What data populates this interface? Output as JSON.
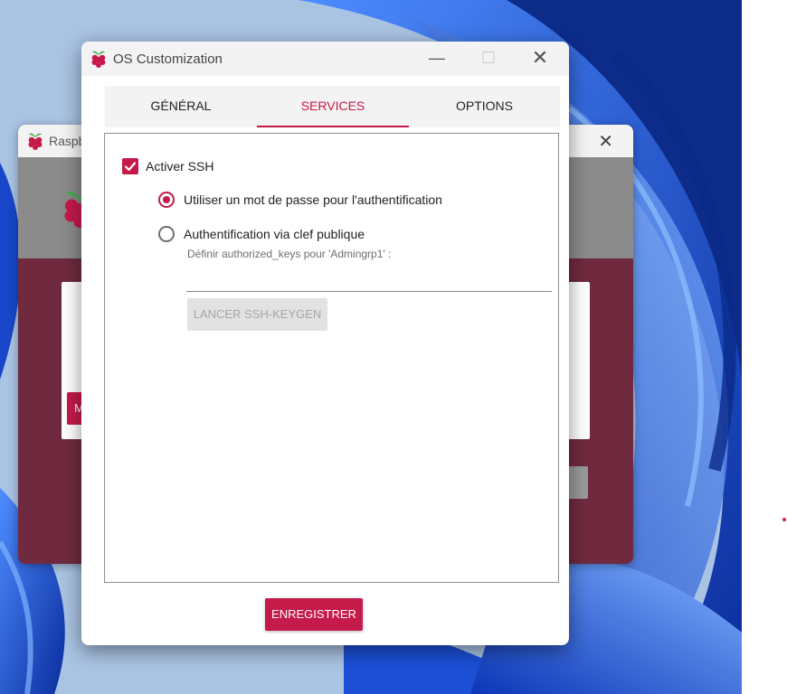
{
  "desktop": {
    "colors": {
      "sky": "#a9c3e3",
      "bloom_dark": "#0a2d9e",
      "bloom_mid": "#1a5de8",
      "bloom_light": "#4d8cff"
    }
  },
  "background_window": {
    "title": "Raspb",
    "icon": "raspberry-icon",
    "close_icon": "close-icon",
    "button_label": "M",
    "colors": {
      "body": "#6f2a3f",
      "header": "#8b8b8b"
    }
  },
  "dialog": {
    "title": "OS Customization",
    "icon": "raspberry-icon",
    "window_controls": {
      "minimize": "—",
      "maximize": "☐",
      "close": "✕"
    },
    "tabs": [
      {
        "label": "GÉNÉRAL",
        "active": false
      },
      {
        "label": "SERVICES",
        "active": true
      },
      {
        "label": "OPTIONS",
        "active": false
      }
    ],
    "services": {
      "ssh_checkbox_label": "Activer SSH",
      "ssh_enabled": true,
      "radio_password_label": "Utiliser un mot de passe pour l'authentification",
      "radio_password_selected": true,
      "radio_pubkey_label": "Authentification via clef publique",
      "radio_pubkey_selected": false,
      "authorized_keys_hint": "Définir authorized_keys pour 'Admingrp1' :",
      "authorized_keys_value": "",
      "keygen_button": "LANCER SSH-KEYGEN"
    },
    "save_button": "ENREGISTRER",
    "colors": {
      "accent": "#c51a4a",
      "titlebar": "#f3f3f3"
    }
  }
}
